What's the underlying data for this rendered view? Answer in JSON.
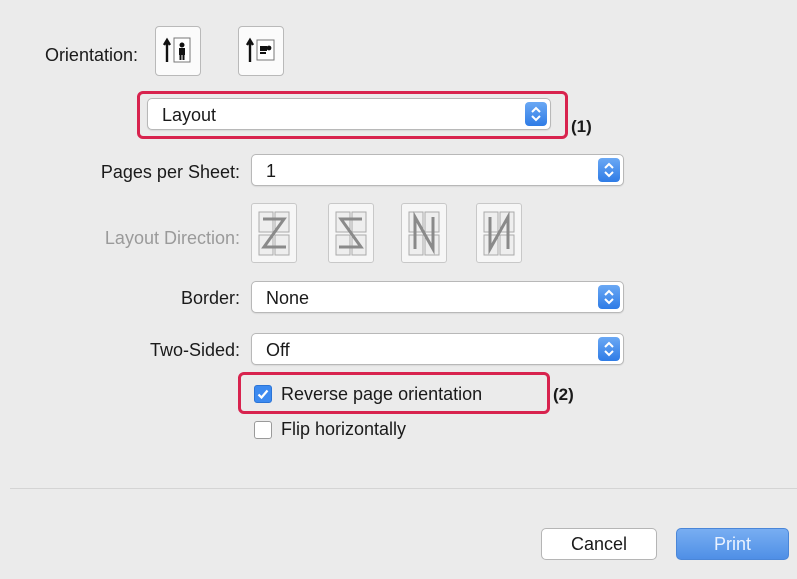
{
  "orientation": {
    "label": "Orientation:",
    "options": [
      "portrait-icon",
      "landscape-icon"
    ]
  },
  "section_popup": {
    "value": "Layout",
    "icon": "stepper-icon"
  },
  "pages_per_sheet": {
    "label": "Pages per Sheet:",
    "value": "1"
  },
  "layout_direction": {
    "label": "Layout Direction:",
    "options": [
      "z-direction-icon",
      "reverse-z-direction-icon",
      "n-direction-icon",
      "reverse-n-direction-icon"
    ]
  },
  "border": {
    "label": "Border:",
    "value": "None"
  },
  "two_sided": {
    "label": "Two-Sided:",
    "value": "Off"
  },
  "reverse_orientation": {
    "label": "Reverse page orientation",
    "checked": true
  },
  "flip_horizontally": {
    "label": "Flip horizontally",
    "checked": false
  },
  "callouts": {
    "one": "(1)",
    "two": "(2)"
  },
  "buttons": {
    "cancel": "Cancel",
    "print": "Print"
  },
  "colors": {
    "accent": "#3c8af0",
    "callout": "#d8234e",
    "background": "#ebebeb"
  }
}
